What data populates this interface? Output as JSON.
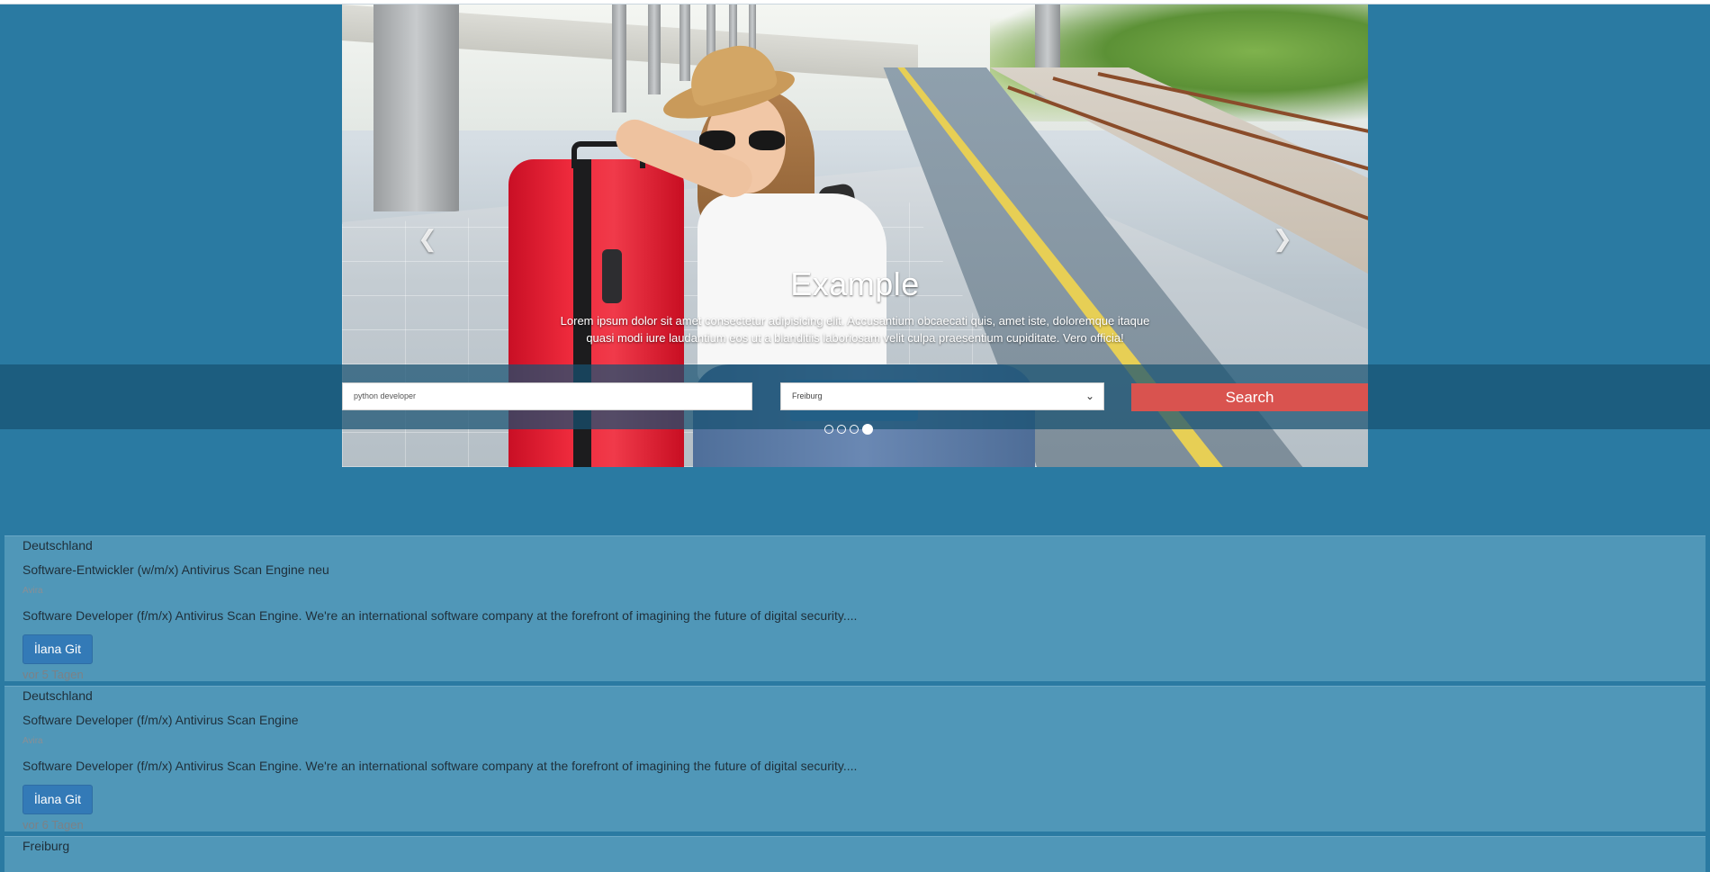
{
  "hero": {
    "caption_title": "Example",
    "caption_text": "Lorem ipsum dolor sit amet consectetur adipisicing elit. Accusantium obcaecati quis, amet iste, doloremque itaque quasi modi iure laudantium eos ut a blanditiis laboriosam velit culpa praesentium cupiditate. Vero officia!",
    "prev_icon": "chevron-left",
    "next_icon": "chevron-right",
    "slides_count": 4,
    "active_slide": 4
  },
  "search": {
    "query_value": "python developer",
    "location_value": "Freiburg",
    "button_label": "Search",
    "button_color": "#d9534f"
  },
  "jobs": [
    {
      "location": "Deutschland",
      "title": "Software-Entwickler (w/m/x) Antivirus Scan Engine neu",
      "company": "Avira",
      "description": "Software Developer (f/m/x) Antivirus Scan Engine. We're an international software company at the forefront of imagining the future of digital security....",
      "apply_label": "İlana Git",
      "age": "vor 5 Tagen"
    },
    {
      "location": "Deutschland",
      "title": "Software Developer (f/m/x) Antivirus Scan Engine",
      "company": "Avira",
      "description": "Software Developer (f/m/x) Antivirus Scan Engine. We're an international software company at the forefront of imagining the future of digital security....",
      "apply_label": "İlana Git",
      "age": "vor 6 Tagen"
    },
    {
      "location": "Freiburg"
    }
  ],
  "colors": {
    "page_background": "#2a7aa2",
    "card_background": "#5097b8",
    "apply_button": "#337ab7"
  }
}
